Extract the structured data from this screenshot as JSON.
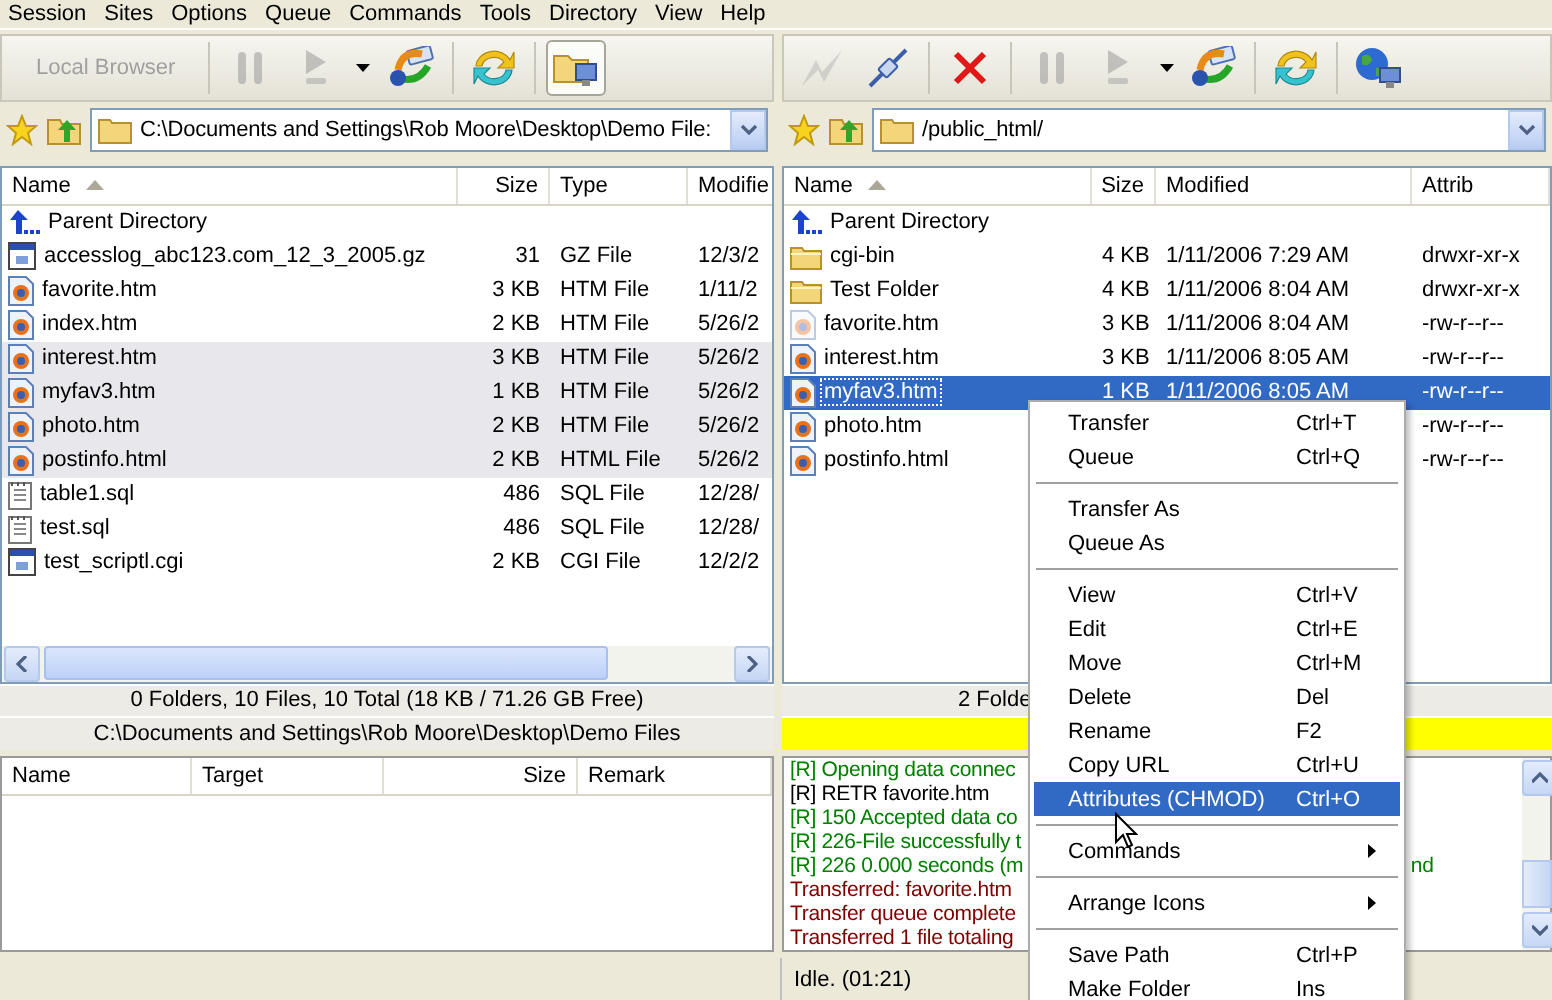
{
  "menu_bar": [
    "Session",
    "Sites",
    "Options",
    "Queue",
    "Commands",
    "Tools",
    "Directory",
    "View",
    "Help"
  ],
  "left_panel": {
    "toolbar": [
      {
        "kind": "label",
        "label": "Local Browser",
        "disabled": true,
        "pressed": false
      },
      {
        "kind": "separator"
      },
      {
        "kind": "pause",
        "disabled": true,
        "pressed": false
      },
      {
        "kind": "go",
        "disabled": true,
        "pressed": false
      },
      {
        "kind": "dropdown",
        "disabled": false,
        "pressed": false
      },
      {
        "kind": "transfer",
        "disabled": false,
        "pressed": false
      },
      {
        "kind": "separator"
      },
      {
        "kind": "refresh",
        "disabled": false,
        "pressed": false
      },
      {
        "kind": "separator"
      },
      {
        "kind": "browser",
        "disabled": false,
        "pressed": true
      }
    ],
    "path": "C:\\Documents and Settings\\Rob Moore\\Desktop\\Demo File:",
    "columns": [
      {
        "label": "Name",
        "sorted": true
      },
      {
        "label": "Size",
        "sorted": false
      },
      {
        "label": "Type",
        "sorted": false
      },
      {
        "label": "Modifie",
        "sorted": false
      }
    ],
    "rows": [
      {
        "kind": "parent",
        "name": "Parent Directory",
        "highlighted": false
      },
      {
        "kind": "window",
        "name": "accesslog_abc123.com_12_3_2005.gz",
        "size": "31",
        "type": "GZ File",
        "modified": "12/3/2",
        "highlighted": false
      },
      {
        "kind": "web",
        "name": "favorite.htm",
        "size": "3 KB",
        "type": "HTM File",
        "modified": "1/11/2",
        "highlighted": false
      },
      {
        "kind": "web",
        "name": "index.htm",
        "size": "2 KB",
        "type": "HTM File",
        "modified": "5/26/2",
        "highlighted": false
      },
      {
        "kind": "web",
        "name": "interest.htm",
        "size": "3 KB",
        "type": "HTM File",
        "modified": "5/26/2",
        "highlighted": true
      },
      {
        "kind": "web",
        "name": "myfav3.htm",
        "size": "1 KB",
        "type": "HTM File",
        "modified": "5/26/2",
        "highlighted": true
      },
      {
        "kind": "web",
        "name": "photo.htm",
        "size": "2 KB",
        "type": "HTM File",
        "modified": "5/26/2",
        "highlighted": true
      },
      {
        "kind": "web",
        "name": "postinfo.html",
        "size": "2 KB",
        "type": "HTML File",
        "modified": "5/26/2",
        "highlighted": true
      },
      {
        "kind": "text",
        "name": "table1.sql",
        "size": "486",
        "type": "SQL File",
        "modified": "12/28/",
        "highlighted": false
      },
      {
        "kind": "text",
        "name": "test.sql",
        "size": "486",
        "type": "SQL File",
        "modified": "12/28/",
        "highlighted": false
      },
      {
        "kind": "window",
        "name": "test_scriptl.cgi",
        "size": "2 KB",
        "type": "CGI File",
        "modified": "12/2/2",
        "highlighted": false
      }
    ],
    "status": "0 Folders, 10 Files, 10 Total (18 KB / 71.26 GB Free)",
    "path_status": "C:\\Documents and Settings\\Rob Moore\\Desktop\\Demo Files"
  },
  "right_panel": {
    "toolbar": [
      {
        "kind": "lightning",
        "disabled": true,
        "pressed": false
      },
      {
        "kind": "plug",
        "disabled": false,
        "pressed": false
      },
      {
        "kind": "separator"
      },
      {
        "kind": "cancel",
        "disabled": false,
        "pressed": false
      },
      {
        "kind": "separator"
      },
      {
        "kind": "pause",
        "disabled": true,
        "pressed": false
      },
      {
        "kind": "go",
        "disabled": true,
        "pressed": false
      },
      {
        "kind": "dropdown",
        "disabled": false,
        "pressed": false
      },
      {
        "kind": "transfer",
        "disabled": false,
        "pressed": false
      },
      {
        "kind": "separator"
      },
      {
        "kind": "refresh",
        "disabled": false,
        "pressed": false
      },
      {
        "kind": "separator"
      },
      {
        "kind": "globe",
        "disabled": false,
        "pressed": false
      }
    ],
    "path": "/public_html/",
    "columns": [
      {
        "label": "Name",
        "sorted": true
      },
      {
        "label": "Size",
        "sorted": false
      },
      {
        "label": "Modified",
        "sorted": false
      },
      {
        "label": "Attrib",
        "sorted": false
      }
    ],
    "rows": [
      {
        "kind": "parent",
        "name": "Parent Directory",
        "selected": false,
        "dimmed": false
      },
      {
        "kind": "folder",
        "name": "cgi-bin",
        "size": "4 KB",
        "modified": "1/11/2006 7:29 AM",
        "attrib": "drwxr-xr-x",
        "selected": false,
        "dimmed": false
      },
      {
        "kind": "folder",
        "name": "Test Folder",
        "size": "4 KB",
        "modified": "1/11/2006 8:04 AM",
        "attrib": "drwxr-xr-x",
        "selected": false,
        "dimmed": false
      },
      {
        "kind": "web",
        "name": "favorite.htm",
        "size": "3 KB",
        "modified": "1/11/2006 8:04 AM",
        "attrib": "-rw-r--r--",
        "selected": false,
        "dimmed": true
      },
      {
        "kind": "web",
        "name": "interest.htm",
        "size": "3 KB",
        "modified": "1/11/2006 8:05 AM",
        "attrib": "-rw-r--r--",
        "selected": false,
        "dimmed": false
      },
      {
        "kind": "web",
        "name": "myfav3.htm",
        "size": "1 KB",
        "modified": "1/11/2006 8:05 AM",
        "attrib": "-rw-r--r--",
        "selected": true,
        "dimmed": false
      },
      {
        "kind": "web",
        "name": "photo.htm",
        "attrib": "-rw-r--r--",
        "selected": false,
        "dimmed": false
      },
      {
        "kind": "web",
        "name": "postinfo.html",
        "attrib": "-rw-r--r--",
        "selected": false,
        "dimmed": false
      }
    ],
    "status": "2 Folde",
    "log": [
      {
        "kind": "reply",
        "text": "[R] Opening data connec"
      },
      {
        "kind": "command",
        "text": "[R] RETR favorite.htm"
      },
      {
        "kind": "reply",
        "text": "[R] 150 Accepted data co"
      },
      {
        "kind": "reply",
        "text": "[R] 226-File successfully t"
      },
      {
        "kind": "reply",
        "text": "[R] 226 0.000 seconds (m",
        "tail": "nd"
      },
      {
        "kind": "info",
        "text": "Transferred: favorite.htm"
      },
      {
        "kind": "info",
        "text": "Transfer queue complete"
      },
      {
        "kind": "info",
        "text": "Transferred 1 file totaling"
      }
    ]
  },
  "queue": {
    "columns": [
      "Name",
      "Target",
      "Size",
      "Remark"
    ]
  },
  "status_bar": {
    "text": "Idle. (01:21)"
  },
  "context_menu": {
    "items": [
      {
        "kind": "item",
        "label": "Transfer",
        "shortcut": "Ctrl+T",
        "selected": false
      },
      {
        "kind": "item",
        "label": "Queue",
        "shortcut": "Ctrl+Q",
        "selected": false
      },
      {
        "kind": "separator"
      },
      {
        "kind": "item",
        "label": "Transfer As",
        "selected": false
      },
      {
        "kind": "item",
        "label": "Queue As",
        "selected": false
      },
      {
        "kind": "separator"
      },
      {
        "kind": "item",
        "label": "View",
        "shortcut": "Ctrl+V",
        "selected": false
      },
      {
        "kind": "item",
        "label": "Edit",
        "shortcut": "Ctrl+E",
        "selected": false
      },
      {
        "kind": "item",
        "label": "Move",
        "shortcut": "Ctrl+M",
        "selected": false
      },
      {
        "kind": "item",
        "label": "Delete",
        "shortcut": "Del",
        "selected": false
      },
      {
        "kind": "item",
        "label": "Rename",
        "shortcut": "F2",
        "selected": false
      },
      {
        "kind": "item",
        "label": "Copy URL",
        "shortcut": "Ctrl+U",
        "selected": false
      },
      {
        "kind": "item",
        "label": "Attributes (CHMOD)",
        "shortcut": "Ctrl+O",
        "selected": true
      },
      {
        "kind": "separator"
      },
      {
        "kind": "submenu",
        "label": "Commands",
        "selected": false
      },
      {
        "kind": "separator"
      },
      {
        "kind": "submenu",
        "label": "Arrange Icons",
        "selected": false
      },
      {
        "kind": "separator"
      },
      {
        "kind": "item",
        "label": "Save Path",
        "shortcut": "Ctrl+P",
        "selected": false
      },
      {
        "kind": "item",
        "label": "Make Folder",
        "shortcut": "Ins",
        "selected": false
      }
    ]
  }
}
